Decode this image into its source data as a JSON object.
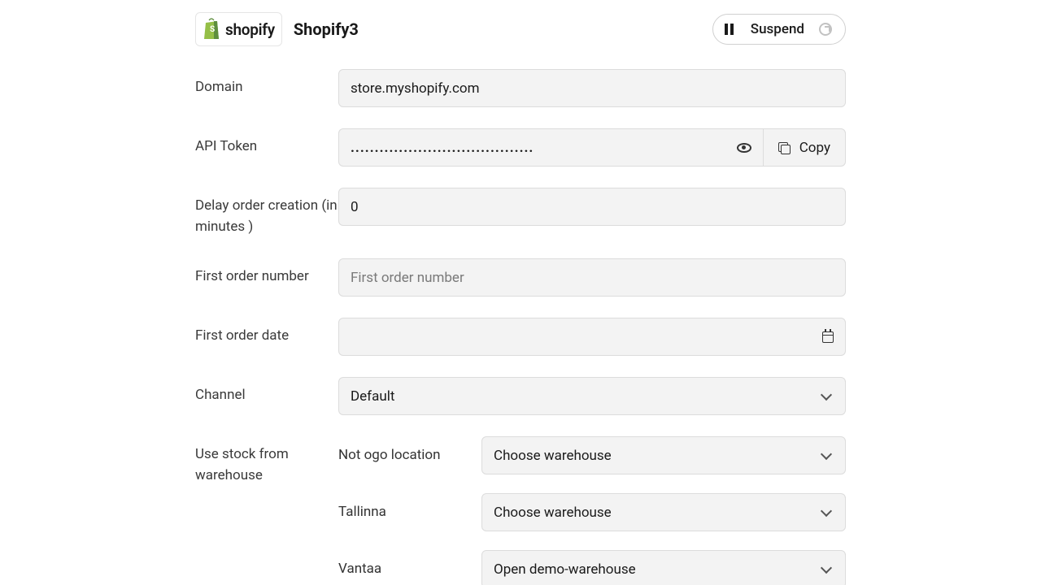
{
  "header": {
    "logo_text": "shopify",
    "title": "Shopify3",
    "suspend_label": "Suspend"
  },
  "fields": {
    "domain": {
      "label": "Domain",
      "value": "store.myshopify.com"
    },
    "api_token": {
      "label": "API Token",
      "value": "......................................",
      "copy_label": "Copy"
    },
    "delay": {
      "label": "Delay order creation (in minutes )",
      "value": "0"
    },
    "first_order_number": {
      "label": "First order number",
      "placeholder": "First order number",
      "value": ""
    },
    "first_order_date": {
      "label": "First order date",
      "value": ""
    },
    "channel": {
      "label": "Channel",
      "value": "Default"
    },
    "use_stock": {
      "label": "Use stock from warehouse",
      "rows": [
        {
          "name": "Not ogo location",
          "value": "Choose warehouse"
        },
        {
          "name": "Tallinna",
          "value": "Choose warehouse"
        },
        {
          "name": "Vantaa",
          "value": "Open demo-warehouse"
        }
      ]
    }
  }
}
